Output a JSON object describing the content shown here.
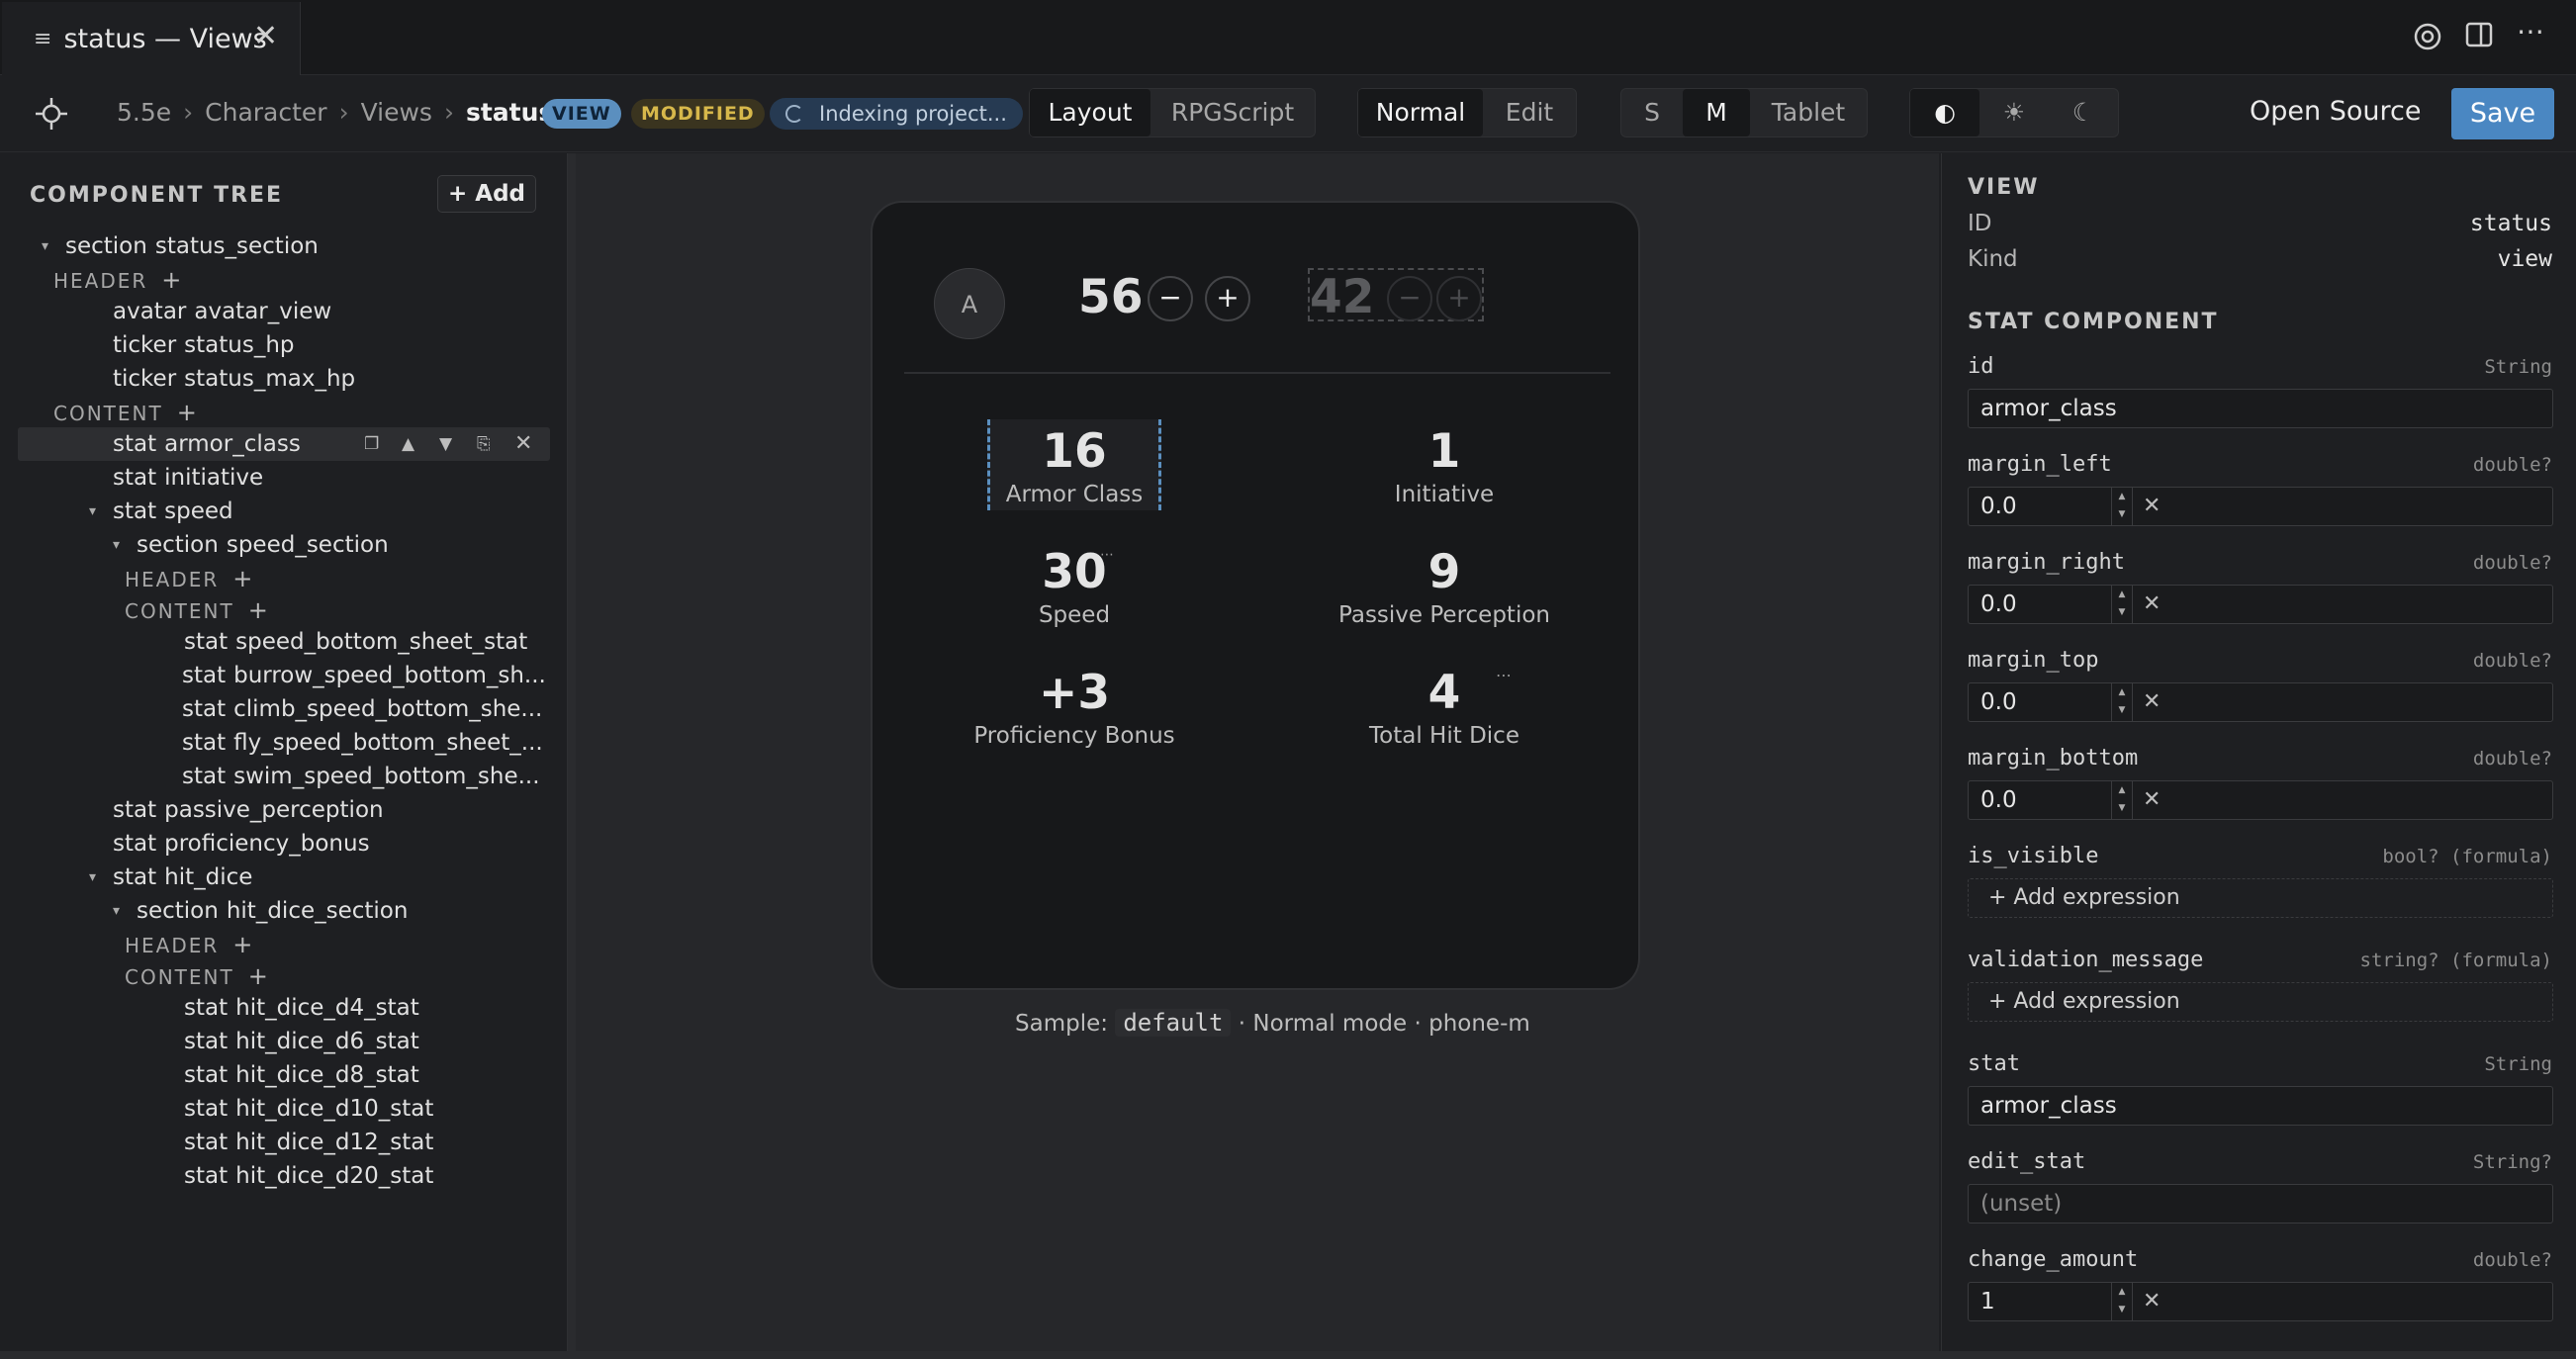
{
  "tab": {
    "title": "status — Views"
  },
  "breadcrumb": {
    "items": [
      "5.5e",
      "Character",
      "Views"
    ],
    "current": "status"
  },
  "badges": {
    "view": "VIEW",
    "modified": "MODIFIED"
  },
  "indexing": "Indexing project...",
  "mode_tabs": [
    "Layout",
    "RPGScript"
  ],
  "edit_tabs": [
    "Normal",
    "Edit"
  ],
  "size_tabs": [
    "S",
    "M",
    "Tablet"
  ],
  "theme_icons": [
    "contrast-icon",
    "sun-icon",
    "moon-icon"
  ],
  "actions": {
    "open_source": "Open Source",
    "save": "Save"
  },
  "tree": {
    "title": "COMPONENT TREE",
    "add": "+ Add",
    "section_status": {
      "kind": "section",
      "name": "status_section"
    },
    "header": "HEADER",
    "content": "CONTENT",
    "avatar": {
      "kind": "avatar",
      "name": "avatar_view"
    },
    "ticker_hp": {
      "kind": "ticker",
      "name": "status_hp"
    },
    "ticker_max": {
      "kind": "ticker",
      "name": "status_max_hp"
    },
    "armor": {
      "kind": "stat",
      "name": "armor_class"
    },
    "initiative": {
      "kind": "stat",
      "name": "initiative"
    },
    "speed": {
      "kind": "stat",
      "name": "speed"
    },
    "speed_section": {
      "kind": "section",
      "name": "speed_section"
    },
    "speed_children": [
      {
        "kind": "stat",
        "name": "speed_bottom_sheet_stat"
      },
      {
        "kind": "stat",
        "name": "burrow_speed_bottom_sh..."
      },
      {
        "kind": "stat",
        "name": "climb_speed_bottom_she..."
      },
      {
        "kind": "stat",
        "name": "fly_speed_bottom_sheet_..."
      },
      {
        "kind": "stat",
        "name": "swim_speed_bottom_she..."
      }
    ],
    "passive": {
      "kind": "stat",
      "name": "passive_perception"
    },
    "prof": {
      "kind": "stat",
      "name": "proficiency_bonus"
    },
    "hit_dice": {
      "kind": "stat",
      "name": "hit_dice"
    },
    "hit_dice_section": {
      "kind": "section",
      "name": "hit_dice_section"
    },
    "hit_dice_children": [
      {
        "kind": "stat",
        "name": "hit_dice_d4_stat"
      },
      {
        "kind": "stat",
        "name": "hit_dice_d6_stat"
      },
      {
        "kind": "stat",
        "name": "hit_dice_d8_stat"
      },
      {
        "kind": "stat",
        "name": "hit_dice_d10_stat"
      },
      {
        "kind": "stat",
        "name": "hit_dice_d12_stat"
      },
      {
        "kind": "stat",
        "name": "hit_dice_d20_stat"
      }
    ]
  },
  "preview": {
    "avatar_letter": "A",
    "hp": "56",
    "max_hp": "42",
    "minus": "−",
    "plus": "+",
    "stats": [
      {
        "value": "16",
        "label": "Armor Class"
      },
      {
        "value": "1",
        "label": "Initiative"
      },
      {
        "value": "30",
        "label": "Speed"
      },
      {
        "value": "9",
        "label": "Passive Perception"
      },
      {
        "value": "+3",
        "label": "Proficiency Bonus"
      },
      {
        "value": "4",
        "label": "Total Hit Dice"
      }
    ],
    "caption_prefix": "Sample:",
    "caption_code": "default",
    "caption_suffix": "· Normal mode · phone-m"
  },
  "inspector": {
    "view_title": "VIEW",
    "id_label": "ID",
    "id_value": "status",
    "kind_label": "Kind",
    "kind_value": "view",
    "component_title": "STAT COMPONENT",
    "fields": {
      "id": {
        "name": "id",
        "type": "String",
        "value": "armor_class"
      },
      "margin_left": {
        "name": "margin_left",
        "type": "double?",
        "value": "0.0"
      },
      "margin_right": {
        "name": "margin_right",
        "type": "double?",
        "value": "0.0"
      },
      "margin_top": {
        "name": "margin_top",
        "type": "double?",
        "value": "0.0"
      },
      "margin_bottom": {
        "name": "margin_bottom",
        "type": "double?",
        "value": "0.0"
      },
      "is_visible": {
        "name": "is_visible",
        "type": "bool? (formula)",
        "value": "+ Add expression"
      },
      "validation_message": {
        "name": "validation_message",
        "type": "string? (formula)",
        "value": "+ Add expression"
      },
      "stat": {
        "name": "stat",
        "type": "String",
        "value": "armor_class"
      },
      "edit_stat": {
        "name": "edit_stat",
        "type": "String?",
        "placeholder": "(unset)"
      },
      "change_amount": {
        "name": "change_amount",
        "type": "double?",
        "value": "1"
      }
    }
  },
  "colors": {
    "accent": "#4a87c2",
    "badge_view": "#5b8fbf",
    "badge_modified": "#d7b84b"
  }
}
